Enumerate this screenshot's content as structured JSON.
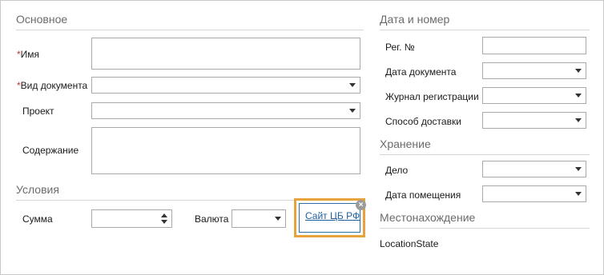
{
  "left": {
    "main_section": "Основное",
    "name_label": "Имя",
    "doc_type_label": "Вид документа",
    "project_label": "Проект",
    "content_label": "Содержание",
    "conditions_section": "Условия",
    "sum_label": "Сумма",
    "currency_label": "Валюта",
    "cbr_link": "Сайт ЦБ РФ",
    "required_mark": "*"
  },
  "right": {
    "date_number_section": "Дата и номер",
    "reg_no_label": "Рег. №",
    "doc_date_label": "Дата документа",
    "journal_label": "Журнал регистрации",
    "delivery_label": "Способ доставки",
    "storage_section": "Хранение",
    "case_label": "Дело",
    "placement_date_label": "Дата помещения",
    "location_section": "Местонахождение",
    "location_state": "LocationState"
  },
  "icons": {
    "close": "×"
  },
  "colors": {
    "highlight": "#e8a23c",
    "link": "#1d5f9e",
    "required": "#c0392b"
  }
}
